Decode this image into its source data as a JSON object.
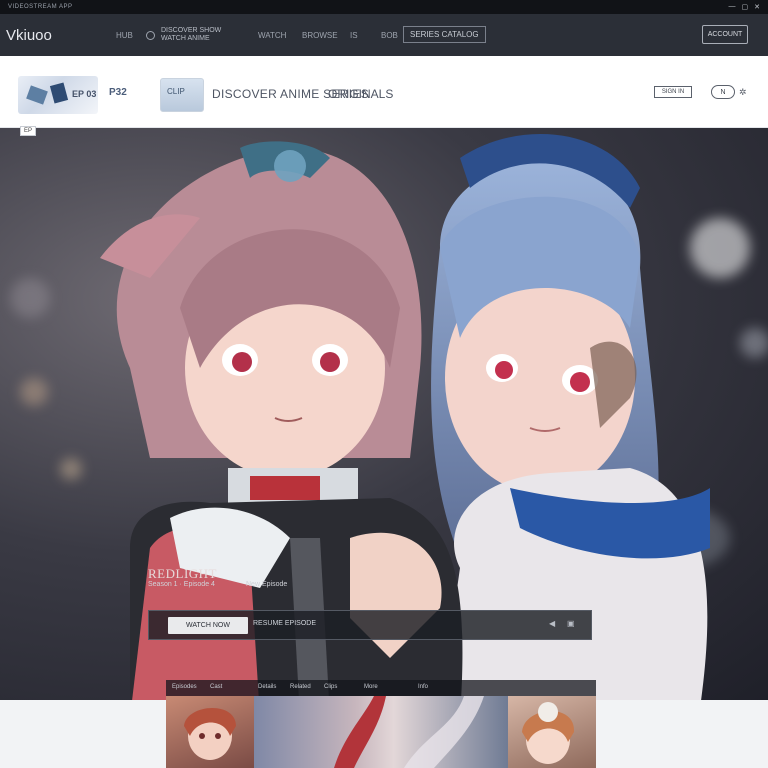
{
  "os": {
    "title": "VIDEOSTREAM APP",
    "controls": [
      "—",
      "▢",
      "✕"
    ]
  },
  "nav": {
    "logo": "Vkiuoo",
    "links": [
      "HUB",
      "WATCH",
      "BROWSE",
      "IS",
      "BOB"
    ],
    "search_text": "DISCOVER SHOW\nWATCH ANIME",
    "boxed_link": "SERIES CATALOG",
    "account_button": "ACCOUNT"
  },
  "subbar": {
    "thumb_a_label": "EP 03",
    "thumb_b_label": "P32",
    "thumb_c_label": "CLIP",
    "title": "DISCOVER ANIME SERIES",
    "title2": "ORIGINALS",
    "button": "SIGN IN",
    "pill": "N",
    "side_tag": "EP"
  },
  "hero": {
    "title": "REDLIGHT",
    "subtitle": "Season 1 · Episode 4",
    "subtitle2": "New Episode",
    "cta": "WATCH NOW",
    "player_text": "RESUME EPISODE",
    "tabs": [
      "Episodes",
      "Cast",
      "Details",
      "Related",
      "Clips",
      "More",
      "Info"
    ]
  },
  "colors": {
    "nav_bg": "#2b2f37",
    "hero_bg": "#2a2b33",
    "accent": "#c94b55",
    "hair_right": "#7d9bc8"
  }
}
